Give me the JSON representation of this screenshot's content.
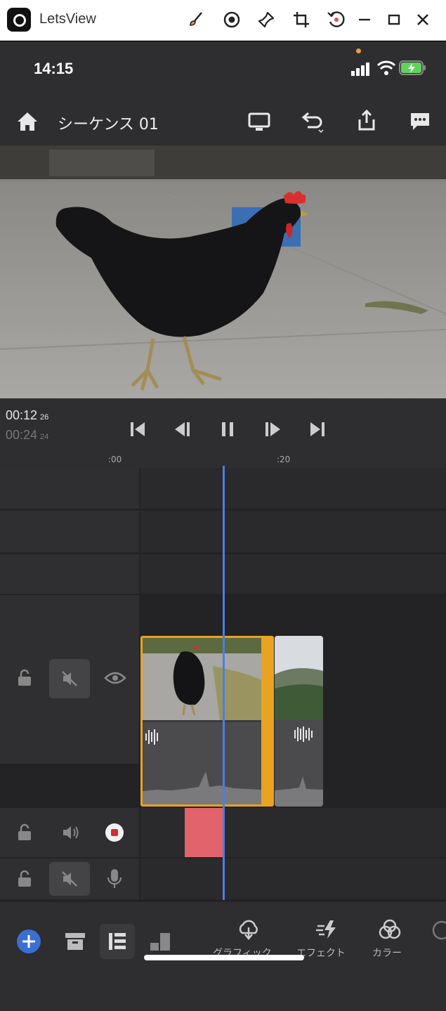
{
  "window": {
    "title": "LetsView",
    "controls": [
      "brush-icon",
      "record-icon",
      "pin-icon",
      "crop-icon",
      "rotate-icon",
      "minimize-icon",
      "maximize-icon",
      "close-icon"
    ]
  },
  "status": {
    "time": "14:15",
    "icons": [
      "signal-icon",
      "wifi-icon",
      "battery-icon"
    ],
    "battery_color": "#5fd35a",
    "indicator_color": "#e7a13a"
  },
  "header": {
    "sequence_title": "シーケンス 01",
    "icons": [
      "home-icon",
      "monitor-icon",
      "undo-icon",
      "share-icon",
      "comment-icon"
    ]
  },
  "transport": {
    "current_time": "00:12",
    "current_frames": "26",
    "duration_time": "00:24",
    "duration_frames": "24",
    "buttons": [
      "skip-to-start-icon",
      "step-back-icon",
      "pause-icon",
      "step-forward-icon",
      "skip-to-end-icon"
    ]
  },
  "ruler": {
    "marks": [
      ":00",
      ":20"
    ]
  },
  "timeline": {
    "playhead_color": "#4a7fe0",
    "clip_border_color": "#e8a322",
    "audio_marker_color": "#e2636c",
    "tracks": [
      {
        "type": "video",
        "muted": true,
        "visible": true
      },
      {
        "type": "audio-record",
        "muted": false
      },
      {
        "type": "audio-mic",
        "muted": true
      },
      {
        "type": "audio-mic",
        "muted": true
      }
    ]
  },
  "toolbar": {
    "left_icons": [
      "add-icon",
      "archive-icon",
      "list-icon",
      "steps-icon"
    ],
    "tools": [
      {
        "name": "graphics",
        "label": "グラフィック"
      },
      {
        "name": "effects",
        "label": "エフェクト"
      },
      {
        "name": "color",
        "label": "カラー"
      }
    ],
    "accent_color": "#3b6fd4"
  }
}
